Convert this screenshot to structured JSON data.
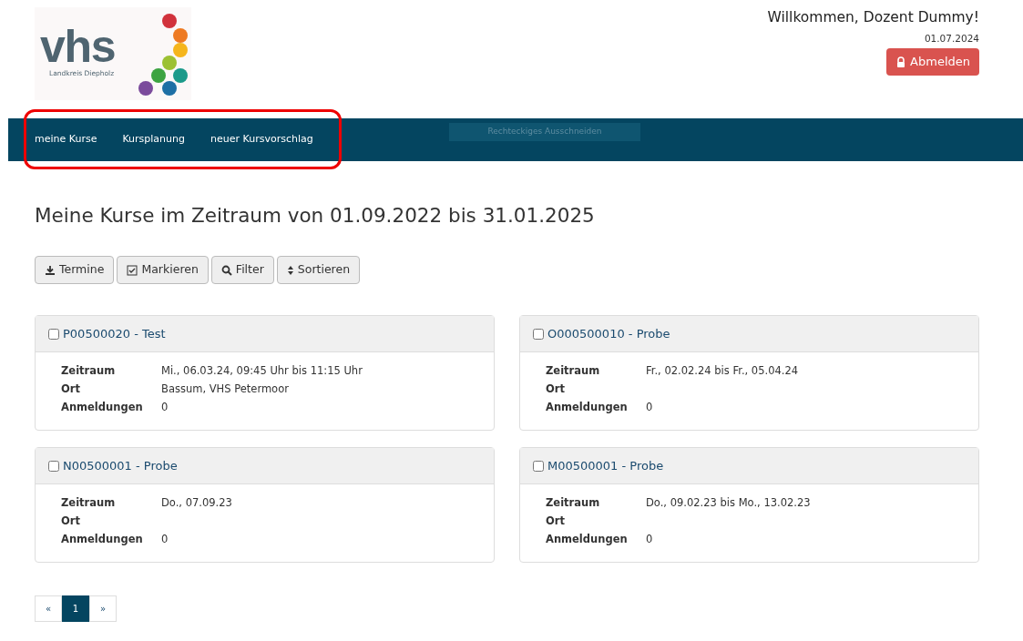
{
  "logo": {
    "wordmark": "vhs",
    "subtitle": "Landkreis Diepholz"
  },
  "header": {
    "welcome": "Willkommen, Dozent Dummy!",
    "date": "01.07.2024",
    "logout": "Abmelden"
  },
  "nav": {
    "items": [
      {
        "label": "meine Kurse"
      },
      {
        "label": "Kursplanung"
      },
      {
        "label": "neuer Kursvorschlag"
      }
    ],
    "overlay_text": "Rechteckiges Ausschneiden",
    "highlighted": true
  },
  "title": "Meine Kurse im Zeitraum von 01.09.2022 bis 31.01.2025",
  "toolbar": [
    {
      "kind": "download",
      "label": "Termine"
    },
    {
      "kind": "check",
      "label": "Markieren"
    },
    {
      "kind": "search",
      "label": "Filter"
    },
    {
      "kind": "sort",
      "label": "Sortieren"
    }
  ],
  "courses": [
    {
      "title": "P00500020 - Test",
      "checked": false,
      "fields": [
        {
          "label": "Zeitraum",
          "value": "Mi., 06.03.24, 09:45 Uhr bis 11:15 Uhr"
        },
        {
          "label": "Ort",
          "value": "Bassum, VHS Petermoor"
        },
        {
          "label": "Anmeldungen",
          "value": "0"
        }
      ]
    },
    {
      "title": "O000500010 - Probe",
      "checked": false,
      "fields": [
        {
          "label": "Zeitraum",
          "value": "Fr., 02.02.24 bis Fr., 05.04.24"
        },
        {
          "label": "Ort"
        },
        {
          "label": "Anmeldungen",
          "value": "0"
        }
      ]
    },
    {
      "title": "N00500001 - Probe",
      "checked": false,
      "fields": [
        {
          "label": "Zeitraum",
          "value": "Do., 07.09.23"
        },
        {
          "label": "Ort"
        },
        {
          "label": "Anmeldungen",
          "value": "0"
        }
      ]
    },
    {
      "title": "M00500001 - Probe",
      "checked": false,
      "fields": [
        {
          "label": "Zeitraum",
          "value": "Do., 09.02.23 bis Mo., 13.02.23"
        },
        {
          "label": "Ort"
        },
        {
          "label": "Anmeldungen",
          "value": "0"
        }
      ]
    }
  ],
  "pagination": [
    {
      "label": "«",
      "selected": false
    },
    {
      "label": "1",
      "selected": true
    },
    {
      "label": "»",
      "selected": false
    }
  ]
}
